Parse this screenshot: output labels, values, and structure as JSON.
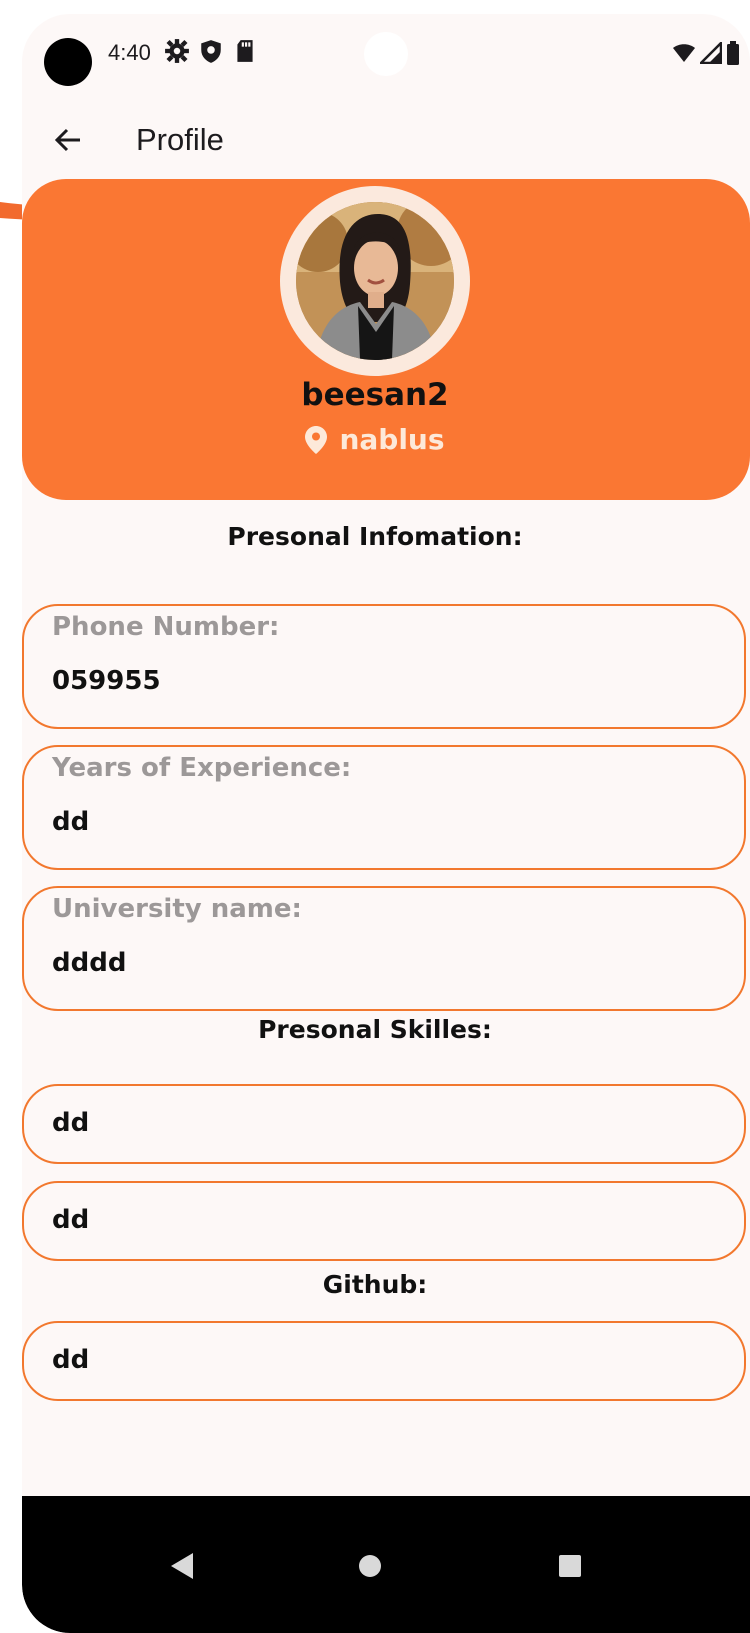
{
  "status_bar": {
    "time": "4:40",
    "left_icons": [
      "gear-icon",
      "shield-icon",
      "sd-card-icon"
    ],
    "right_icons": [
      "wifi-icon",
      "cell-signal-icon",
      "battery-icon"
    ]
  },
  "app_bar": {
    "title": "Profile",
    "back_icon": "arrow-back-icon"
  },
  "profile": {
    "username": "beesan2",
    "location": "nablus",
    "location_icon": "location-pin-icon"
  },
  "personal_info": {
    "title": "Presonal Infomation:",
    "fields": [
      {
        "label": "Phone Number:",
        "value": "059955"
      },
      {
        "label": "Years of Experience:",
        "value": "dd"
      },
      {
        "label": "University name:",
        "value": "dddd"
      }
    ]
  },
  "skills": {
    "title": "Presonal Skilles:",
    "items": [
      "dd",
      "dd"
    ]
  },
  "github": {
    "title": "Github:",
    "value": "dd"
  },
  "nav_bar": {
    "buttons": [
      "back-triangle-icon",
      "home-circle-icon",
      "recents-square-icon"
    ]
  },
  "colors": {
    "accent": "#fa7733",
    "field_border": "#f2782e",
    "background": "#fdf8f7",
    "label_gray": "#9c9898",
    "location_text": "#fde9d9",
    "annotation_arrow": "#f26a2e"
  }
}
